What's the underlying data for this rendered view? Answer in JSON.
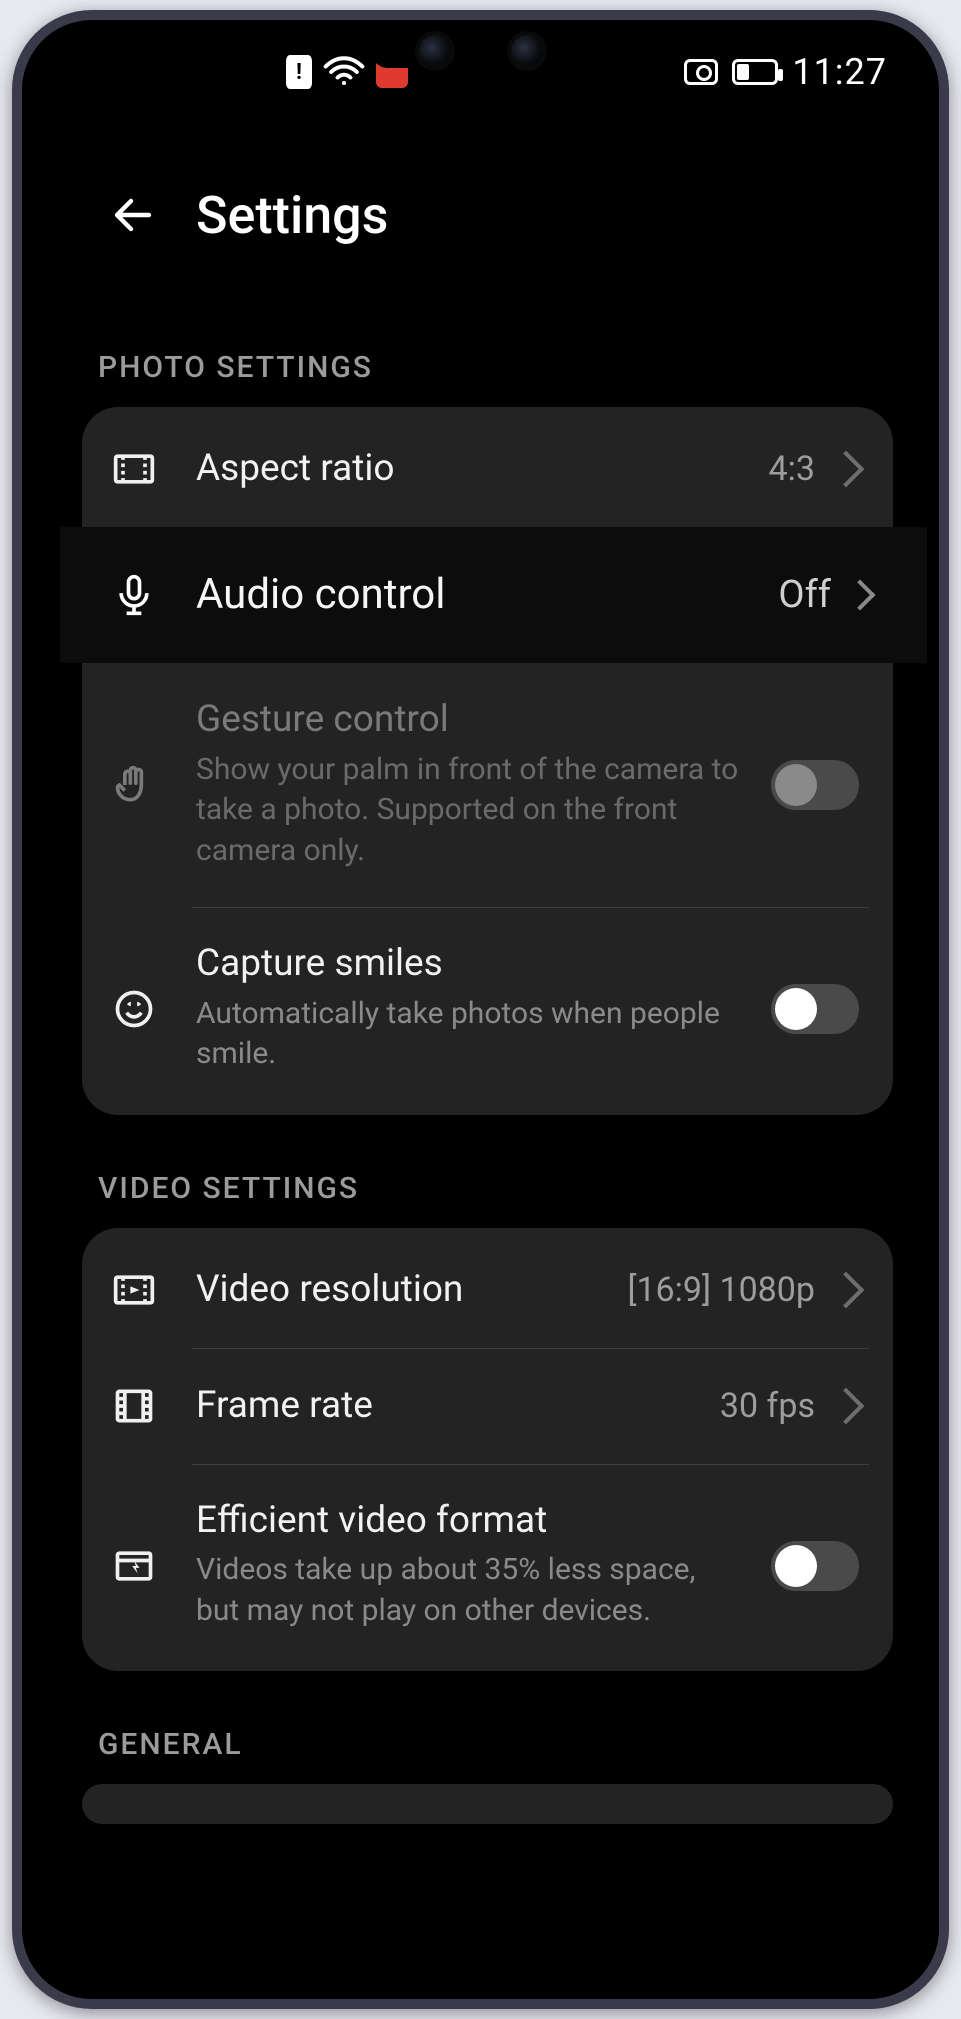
{
  "status_bar": {
    "time": "11:27"
  },
  "header": {
    "title": "Settings"
  },
  "sections": {
    "photo": {
      "label": "PHOTO SETTINGS",
      "aspect_ratio": {
        "title": "Aspect ratio",
        "value": "4:3"
      },
      "audio_control": {
        "title": "Audio control",
        "value": "Off"
      },
      "gesture_control": {
        "title": "Gesture control",
        "sub": "Show your palm in front of the camera to take a photo. Supported on the front camera only."
      },
      "capture_smiles": {
        "title": "Capture smiles",
        "sub": "Automatically take photos when people smile."
      }
    },
    "video": {
      "label": "VIDEO SETTINGS",
      "resolution": {
        "title": "Video resolution",
        "value": "[16:9] 1080p"
      },
      "frame_rate": {
        "title": "Frame rate",
        "value": "30 fps"
      },
      "efficient_format": {
        "title": "Efficient video format",
        "sub": "Videos take up about 35% less space, but may not play on other devices."
      }
    },
    "general": {
      "label": "GENERAL"
    }
  }
}
